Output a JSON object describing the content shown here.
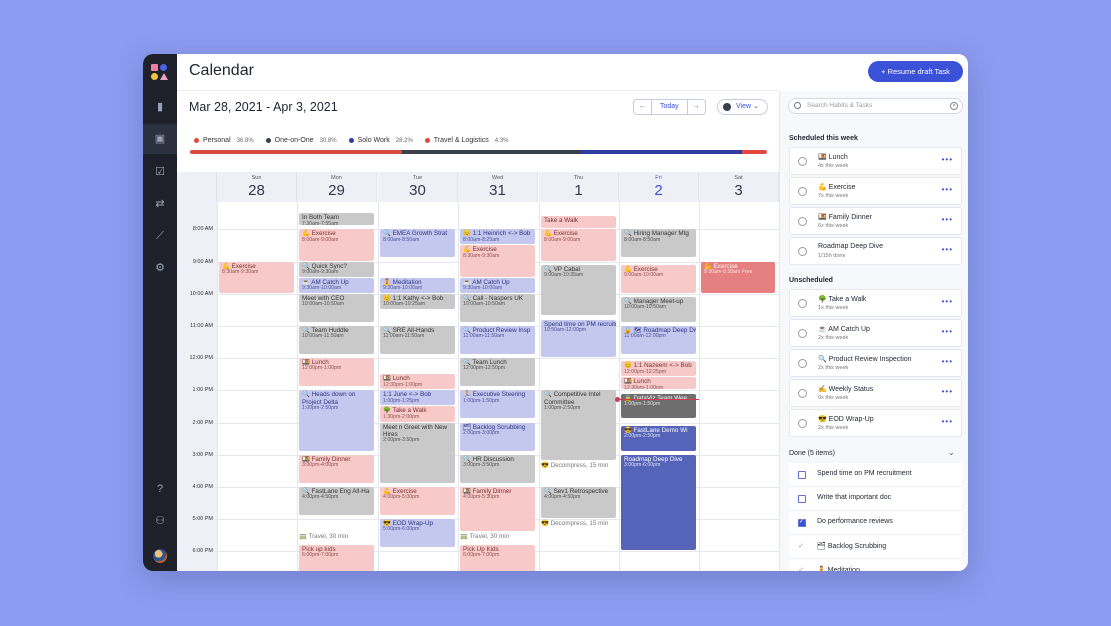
{
  "header": {
    "title": "Calendar",
    "resume_button": "+ Resume draft Task",
    "date_range": "Mar 28, 2021 - Apr 3, 2021",
    "prev": "←",
    "today": "Today",
    "next": "→",
    "view": "View ⌄"
  },
  "legend": [
    {
      "label": "Personal",
      "pct": "36.8%",
      "color": "#e3483f"
    },
    {
      "label": "One-on-One",
      "pct": "30.8%",
      "color": "#3b3f4a"
    },
    {
      "label": "Solo Work",
      "pct": "28.2%",
      "color": "#2e3c9e"
    },
    {
      "label": "Travel & Logistics",
      "pct": "4.3%",
      "color": "#e3483f"
    }
  ],
  "days": [
    {
      "dn": "Sun",
      "num": "28"
    },
    {
      "dn": "Mon",
      "num": "29"
    },
    {
      "dn": "Tue",
      "num": "30"
    },
    {
      "dn": "Wed",
      "num": "31"
    },
    {
      "dn": "Thu",
      "num": "1"
    },
    {
      "dn": "Fri",
      "num": "2"
    },
    {
      "dn": "Sat",
      "num": "3"
    }
  ],
  "times": [
    "8:00 AM",
    "9:00 AM",
    "10:00 AM",
    "11:00 AM",
    "12:00 PM",
    "1:00 PM",
    "2:00 PM",
    "3:00 PM",
    "4:00 PM",
    "5:00 PM",
    "6:00 PM"
  ],
  "events": [
    {
      "d": 0,
      "start": 9.0,
      "end": 10.0,
      "c": "pink",
      "t": "💪 Exercise",
      "s": "8:30am-9:30am"
    },
    {
      "d": 1,
      "start": 7.5,
      "end": 7.9,
      "c": "gray",
      "t": "In Both Team",
      "s": "7:30am-7:55am"
    },
    {
      "d": 1,
      "start": 8.0,
      "end": 9.0,
      "c": "pink",
      "t": "💪 Exercise",
      "s": "8:00am-9:00am"
    },
    {
      "d": 1,
      "start": 9.0,
      "end": 9.5,
      "c": "gray",
      "t": "🔍 Quick Sync?",
      "s": "9:00am-9:30am"
    },
    {
      "d": 1,
      "start": 9.5,
      "end": 10.0,
      "c": "blue",
      "t": "☕ AM Catch Up",
      "s": "9:30am-10:00am"
    },
    {
      "d": 1,
      "start": 10.0,
      "end": 10.9,
      "c": "gray",
      "t": "Meet with CEO",
      "s": "10:00am-10:50am"
    },
    {
      "d": 1,
      "start": 11.0,
      "end": 11.9,
      "c": "gray",
      "t": "🔍 Team Huddle",
      "s": "10:00am-11:50am"
    },
    {
      "d": 1,
      "start": 12.0,
      "end": 12.9,
      "c": "pink",
      "t": "🍱 Lunch",
      "s": "12:00pm-1:00pm"
    },
    {
      "d": 1,
      "start": 13.0,
      "end": 14.9,
      "c": "blue",
      "t": "🔍 Heads down on Project Delta",
      "s": "1:00pm-2:50pm"
    },
    {
      "d": 1,
      "start": 15.0,
      "end": 15.9,
      "c": "pink",
      "t": "🍱 Family Dinner",
      "s": "3:00pm-4:00pm"
    },
    {
      "d": 1,
      "start": 16.0,
      "end": 16.9,
      "c": "gray",
      "t": "🔍 FastLane Eng All-Ha",
      "s": "4:00pm-4:50pm"
    },
    {
      "d": 1,
      "start": 17.4,
      "end": 17.8,
      "c": "note",
      "t": "🚃 Travel, 30 min",
      "s": ""
    },
    {
      "d": 1,
      "start": 17.8,
      "end": 18.9,
      "c": "pink",
      "t": "Pick up kids",
      "s": "6:00pm-7:00pm"
    },
    {
      "d": 2,
      "start": 8.0,
      "end": 8.9,
      "c": "blue",
      "t": "🔍 EMEA Growth Strat",
      "s": "8:00am-8:50am"
    },
    {
      "d": 2,
      "start": 9.5,
      "end": 10.0,
      "c": "blue",
      "t": "🧘 Meditation",
      "s": "9:30am-10:00am"
    },
    {
      "d": 2,
      "start": 10.0,
      "end": 10.5,
      "c": "gray",
      "t": "😊 1:1 Kathy <-> Bob",
      "s": "10:00am-10:25am"
    },
    {
      "d": 2,
      "start": 11.0,
      "end": 11.9,
      "c": "gray",
      "t": "🔍 SRE All-Hands",
      "s": "11:00am-11:50am"
    },
    {
      "d": 2,
      "start": 12.5,
      "end": 13.0,
      "c": "pink",
      "t": "🍱 Lunch",
      "s": "12:30pm-1:00pm"
    },
    {
      "d": 2,
      "start": 13.0,
      "end": 13.5,
      "c": "blue",
      "t": "1:1 June <-> Bob",
      "s": "1:00pm-1:25pm"
    },
    {
      "d": 2,
      "start": 13.5,
      "end": 14.0,
      "c": "pink",
      "t": "🌳 Take a Walk",
      "s": "1:30pm-2:00pm"
    },
    {
      "d": 2,
      "start": 14.0,
      "end": 15.9,
      "c": "gray",
      "t": "Meet n Greet with New Hires",
      "s": "2:00pm-3:50pm"
    },
    {
      "d": 2,
      "start": 16.0,
      "end": 16.9,
      "c": "pink",
      "t": "💪 Exercise",
      "s": "4:00pm-5:00pm"
    },
    {
      "d": 2,
      "start": 17.0,
      "end": 17.9,
      "c": "blue",
      "t": "😎 EOD Wrap-Up",
      "s": "5:00pm-6:00pm"
    },
    {
      "d": 3,
      "start": 8.0,
      "end": 8.5,
      "c": "blue",
      "t": "😊 1:1 Heinrich <-> Bob",
      "s": "8:00am-8:25am"
    },
    {
      "d": 3,
      "start": 8.5,
      "end": 9.5,
      "c": "pink",
      "t": "💪 Exercise",
      "s": "8:30am-9:30am"
    },
    {
      "d": 3,
      "start": 9.5,
      "end": 10.0,
      "c": "blue",
      "t": "☕ AM Catch Up",
      "s": "9:30am-10:00am"
    },
    {
      "d": 3,
      "start": 10.0,
      "end": 10.9,
      "c": "gray",
      "t": "🔍 Call - Naspers UK",
      "s": "10:00am-10:50am"
    },
    {
      "d": 3,
      "start": 11.0,
      "end": 11.9,
      "c": "blue",
      "t": "🔍 Product Review Insp",
      "s": "11:00am-11:50am"
    },
    {
      "d": 3,
      "start": 12.0,
      "end": 12.9,
      "c": "gray",
      "t": "🔍 Team Lunch",
      "s": "12:00pm-12:50pm"
    },
    {
      "d": 3,
      "start": 13.0,
      "end": 13.9,
      "c": "blue",
      "t": "🏃 Executive Steering",
      "s": "1:00pm-1:50pm"
    },
    {
      "d": 3,
      "start": 14.0,
      "end": 14.9,
      "c": "blue",
      "t": "🗂 Backlog Scrubbing",
      "s": "2:00pm-3:00pm"
    },
    {
      "d": 3,
      "start": 15.0,
      "end": 15.9,
      "c": "gray",
      "t": "🔍 HR Discussion",
      "s": "3:00pm-3:50pm"
    },
    {
      "d": 3,
      "start": 16.0,
      "end": 17.4,
      "c": "pink",
      "t": "🍱 Family Dinner",
      "s": "4:00pm-5:30pm"
    },
    {
      "d": 3,
      "start": 17.4,
      "end": 17.8,
      "c": "note",
      "t": "🚃 Travel, 30 min",
      "s": ""
    },
    {
      "d": 3,
      "start": 17.8,
      "end": 18.9,
      "c": "pink",
      "t": "Pick Up Kids",
      "s": "6:00pm-7:00pm"
    },
    {
      "d": 4,
      "start": 7.6,
      "end": 8.0,
      "c": "pink",
      "t": "Take a Walk",
      "s": ""
    },
    {
      "d": 4,
      "start": 8.0,
      "end": 9.0,
      "c": "pink",
      "t": "💪 Exercise",
      "s": "8:00am-9:00am"
    },
    {
      "d": 4,
      "start": 9.1,
      "end": 10.7,
      "c": "gray",
      "t": "🔍 VP Cabal",
      "s": "9:00am-10:35am"
    },
    {
      "d": 4,
      "start": 10.8,
      "end": 12.0,
      "c": "blue",
      "t": "Spend time on PM recruitment",
      "s": "10:50am-12:00pm"
    },
    {
      "d": 4,
      "start": 13.0,
      "end": 15.2,
      "c": "gray",
      "t": "🔍 Competitive Intel Committee",
      "s": "1:00pm-2:50pm"
    },
    {
      "d": 4,
      "start": 15.2,
      "end": 15.5,
      "c": "note",
      "t": "😎 Decompress, 15 min",
      "s": ""
    },
    {
      "d": 4,
      "start": 16.0,
      "end": 17.0,
      "c": "gray",
      "t": "🔍 Sev1 Retrospective",
      "s": "4:00pm-4:50pm"
    },
    {
      "d": 4,
      "start": 17.0,
      "end": 17.3,
      "c": "note",
      "t": "😎 Decompress, 15 min",
      "s": ""
    },
    {
      "d": 5,
      "start": 8.0,
      "end": 8.9,
      "c": "gray",
      "t": "🔍 Hiring Manager Mtg",
      "s": "8:00am-8:50am"
    },
    {
      "d": 5,
      "start": 9.1,
      "end": 10.0,
      "c": "pink",
      "t": "💪 Exercise",
      "s": "9:00am-10:00am"
    },
    {
      "d": 5,
      "start": 10.1,
      "end": 10.9,
      "c": "gray",
      "t": "🔍 Manager Meet-up",
      "s": "10:00am-10:50am"
    },
    {
      "d": 5,
      "start": 11.0,
      "end": 11.9,
      "c": "blue",
      "t": "🔒 🗺 Roadmap Deep Dive",
      "s": "11:00am-12:00pm"
    },
    {
      "d": 5,
      "start": 12.1,
      "end": 12.6,
      "c": "pink",
      "t": "😊 1:1 Nazeem <-> Bob",
      "s": "12:00pm-12:25pm"
    },
    {
      "d": 5,
      "start": 12.6,
      "end": 13.0,
      "c": "pink",
      "t": "🍱 Lunch",
      "s": "12:30pm-1:00pm"
    },
    {
      "d": 5,
      "start": 13.1,
      "end": 13.9,
      "c": "dark",
      "t": "🔒 DataViz Team Wee",
      "s": "1:00pm-1:50pm"
    },
    {
      "d": 5,
      "start": 14.1,
      "end": 14.9,
      "c": "navy",
      "t": "😎 FastLane Demo Wi",
      "s": "2:00pm-2:50pm"
    },
    {
      "d": 5,
      "start": 15.0,
      "end": 18.0,
      "c": "navy",
      "t": "Roadmap Deep Dive",
      "s": "3:00pm-6:00pm"
    },
    {
      "d": 6,
      "start": 9.0,
      "end": 10.0,
      "c": "red",
      "t": "💪 Exercise",
      "s": "8:30am-9:30am Free"
    }
  ],
  "panel": {
    "search_placeholder": "Search Habits & Tasks",
    "scheduled_title": "Scheduled this week",
    "scheduled": [
      {
        "name": "🍱 Lunch",
        "sub": "4x this week"
      },
      {
        "name": "💪 Exercise",
        "sub": "7x this week"
      },
      {
        "name": "🍱 Family Dinner",
        "sub": "6x this week"
      },
      {
        "name": "Roadmap Deep Dive",
        "sub": "1/15h done"
      }
    ],
    "unscheduled_title": "Unscheduled",
    "unscheduled": [
      {
        "name": "🌳 Take a Walk",
        "sub": "1x this week"
      },
      {
        "name": "☕ AM Catch Up",
        "sub": "2x this week"
      },
      {
        "name": "🔍 Product Review Inspection",
        "sub": "2x this week"
      },
      {
        "name": "✍️ Weekly Status",
        "sub": "0x this week"
      },
      {
        "name": "😎 EOD Wrap-Up",
        "sub": "2x this week"
      }
    ],
    "done_title": "Done (5 items)",
    "done": [
      {
        "name": "Spend time on PM recruitment",
        "state": "box"
      },
      {
        "name": "Write that important doc",
        "state": "box"
      },
      {
        "name": "Do performance reviews",
        "state": "checked"
      },
      {
        "name": "🗂 Backlog Scrubbing",
        "state": "tick"
      },
      {
        "name": "🧘 Meditation",
        "state": "tick"
      }
    ]
  }
}
